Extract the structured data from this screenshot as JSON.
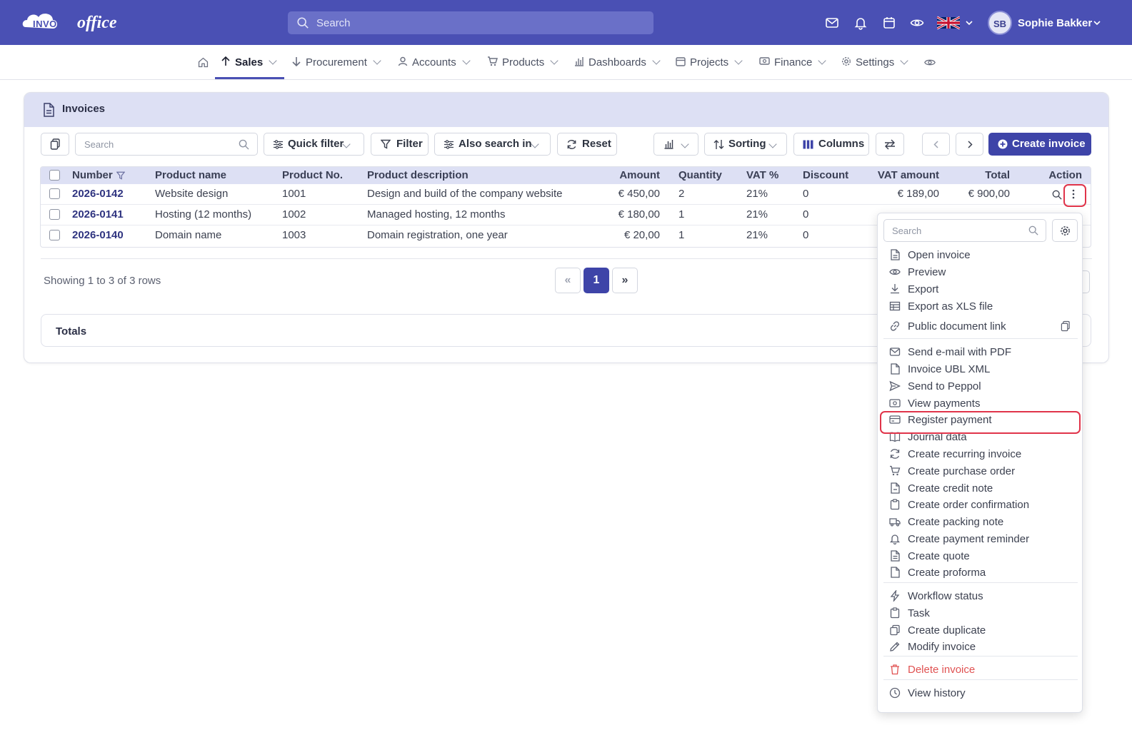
{
  "header": {
    "logo_text_invoice": "INVOICE",
    "logo_text_office": "office",
    "search_placeholder": "Search",
    "user_initials": "SB",
    "user_name": "Sophie Bakker",
    "accent": "#4a50b4"
  },
  "nav": {
    "items": [
      {
        "label": "Sales",
        "active": true
      },
      {
        "label": "Procurement"
      },
      {
        "label": "Accounts"
      },
      {
        "label": "Products"
      },
      {
        "label": "Dashboards"
      },
      {
        "label": "Projects"
      },
      {
        "label": "Finance"
      },
      {
        "label": "Settings"
      }
    ]
  },
  "panel": {
    "title": "Invoices",
    "toolbar": {
      "search_placeholder": "Search",
      "quick_filter": "Quick filter",
      "filter": "Filter",
      "also_search_in": "Also search in",
      "reset": "Reset",
      "sorting": "Sorting",
      "columns": "Columns",
      "create_invoice": "Create invoice"
    }
  },
  "table": {
    "headers": [
      "Number",
      "Product name",
      "Product No.",
      "Product description",
      "Amount",
      "Quantity",
      "VAT %",
      "Discount",
      "VAT amount",
      "Total",
      "Action"
    ],
    "rows": [
      {
        "number": "2026-0142",
        "product_name": "Website design",
        "product_no": "1001",
        "description": "Design and build of the company website",
        "amount": "€ 450,00",
        "quantity": "2",
        "vat": "21%",
        "discount": "0",
        "vat_amount": "€ 189,00",
        "total": "€ 900,00"
      },
      {
        "number": "2026-0141",
        "product_name": "Hosting (12 months)",
        "product_no": "1002",
        "description": "Managed hosting, 12 months",
        "amount": "€ 180,00",
        "quantity": "1",
        "vat": "21%",
        "discount": "0"
      },
      {
        "number": "2026-0140",
        "product_name": "Domain name",
        "product_no": "1003",
        "description": "Domain registration, one year",
        "amount": "€ 20,00",
        "quantity": "1",
        "vat": "21%",
        "discount": "0"
      }
    ]
  },
  "pagination": {
    "showing": "Showing 1 to 3 of 3 rows",
    "prev": "«",
    "current": "1",
    "next": "»"
  },
  "totals": {
    "label": "Totals"
  },
  "action_menu": {
    "search_placeholder": "Search",
    "items": [
      {
        "label": "Open invoice",
        "icon": "document-icon"
      },
      {
        "label": "Preview",
        "icon": "eye-icon"
      },
      {
        "label": "Export",
        "icon": "download-icon"
      },
      {
        "label": "Export as XLS file",
        "icon": "table-icon"
      },
      {
        "label": "Public document link",
        "icon": "link-icon"
      },
      {
        "label": "Send e-mail with PDF",
        "icon": "mail-icon"
      },
      {
        "label": "Invoice UBL XML",
        "icon": "file-icon"
      },
      {
        "label": "Send to Peppol",
        "icon": "send-icon"
      },
      {
        "label": "View payments",
        "icon": "money-icon"
      },
      {
        "label": "Register payment",
        "icon": "credit-card-icon",
        "highlighted": true
      },
      {
        "label": "Journal data",
        "icon": "book-icon"
      },
      {
        "label": "Create recurring invoice",
        "icon": "refresh-icon"
      },
      {
        "label": "Create purchase order",
        "icon": "cart-icon"
      },
      {
        "label": "Create credit note",
        "icon": "file-minus-icon"
      },
      {
        "label": "Create order confirmation",
        "icon": "clipboard-icon"
      },
      {
        "label": "Create packing note",
        "icon": "truck-icon"
      },
      {
        "label": "Create payment reminder",
        "icon": "bell-icon"
      },
      {
        "label": "Create quote",
        "icon": "file-text-icon"
      },
      {
        "label": "Create proforma",
        "icon": "file-icon"
      },
      {
        "label": "Workflow status",
        "icon": "bolt-icon"
      },
      {
        "label": "Task",
        "icon": "clipboard-icon"
      },
      {
        "label": "Create duplicate",
        "icon": "copy-icon"
      },
      {
        "label": "Modify invoice",
        "icon": "edit-icon"
      },
      {
        "label": "Delete invoice",
        "icon": "trash-icon",
        "danger": true
      },
      {
        "label": "View history",
        "icon": "clock-icon"
      }
    ]
  },
  "colors": {
    "primary": "#3e44a8",
    "highlight": "#e0344a",
    "danger": "#e05252",
    "header_bg": "#dde0f4"
  }
}
